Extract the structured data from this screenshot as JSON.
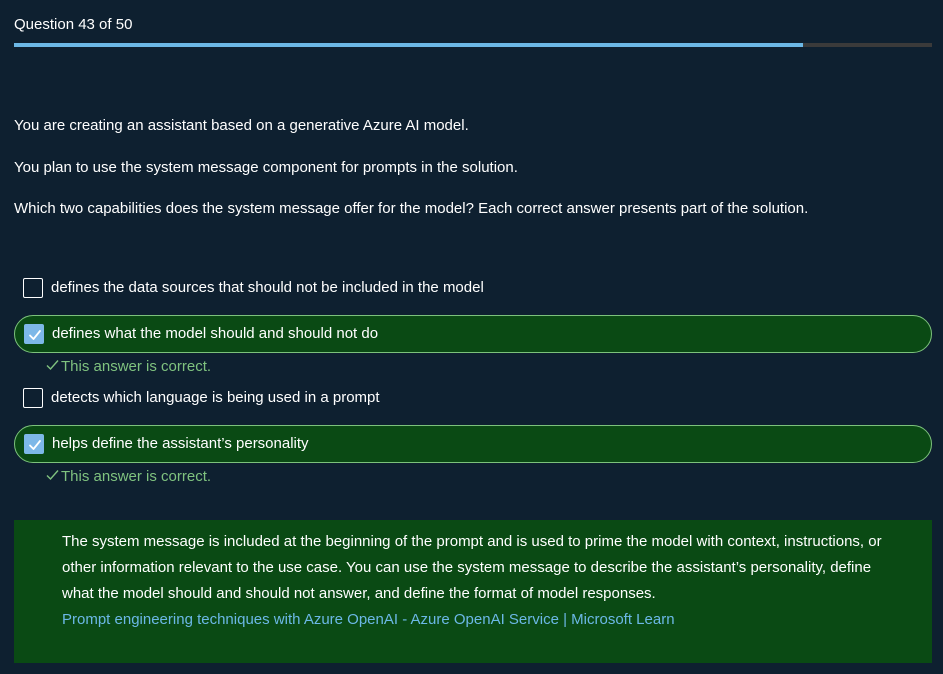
{
  "header": {
    "counter": "Question 43 of 50"
  },
  "progress": {
    "fraction": 0.86
  },
  "question": {
    "lines": [
      "You are creating an assistant based on a generative Azure AI model.",
      "You plan to use the system message component for prompts in the solution.",
      "Which two capabilities does the system message offer for the model? Each correct answer presents part of the solution."
    ]
  },
  "options": [
    {
      "label": "defines the data sources that should not be included in the model",
      "checked": false,
      "correct": false
    },
    {
      "label": "defines what the model should and should not do",
      "checked": true,
      "correct": true,
      "feedback": "This answer is correct."
    },
    {
      "label": "detects which language is being used in a prompt",
      "checked": false,
      "correct": false
    },
    {
      "label": "helps define the assistant’s personality",
      "checked": true,
      "correct": true,
      "feedback": "This answer is correct."
    }
  ],
  "explanation": {
    "text": "The system message is included at the beginning of the prompt and is used to prime the model with context, instructions, or other information relevant to the use case. You can use the system message to describe the assistant’s personality, define what the model should and should not answer, and define the format of model responses.",
    "link_text": "Prompt engineering techniques with Azure OpenAI - Azure OpenAI Service | Microsoft Learn"
  },
  "colors": {
    "background": "#0e2030",
    "progress_fill": "#6cb8e6",
    "correct_bg": "#0a4a14",
    "correct_text": "#7fc27f",
    "link": "#6cb8e6"
  }
}
